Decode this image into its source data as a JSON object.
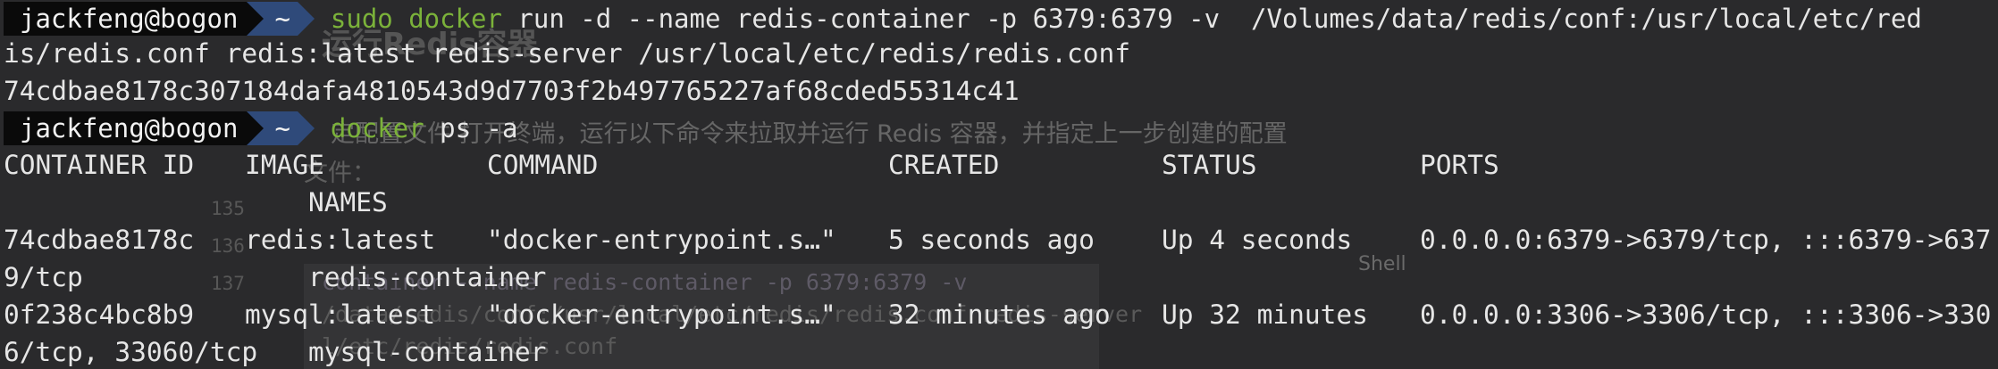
{
  "window": {
    "background": "#2a2a2c",
    "prompt_user_bg": "#0a0a0a",
    "prompt_dir_bg": "#2f4a7a",
    "command_color": "#7bb23a"
  },
  "prompts": [
    {
      "user": "jackfeng@bogon",
      "dir": "~",
      "cmd_keyword": "sudo docker",
      "cmd_args": " run -d --name redis-container -p 6379:6379 -v  /Volumes/data/redis/conf:/usr/local/etc/red"
    },
    {
      "user": "jackfeng@bogon",
      "dir": "~",
      "cmd_keyword": "docker",
      "cmd_args": " ps -a"
    }
  ],
  "output": {
    "wrap_line": "is/redis.conf redis:latest redis-server /usr/local/etc/redis/redis.conf",
    "container_hash": "74cdbae8178c307184dafa4810543d9d7703f2b497765227af68cded55314c41"
  },
  "table": {
    "headers": {
      "container_id": "CONTAINER ID",
      "image": "IMAGE",
      "command": "COMMAND",
      "created": "CREATED",
      "status": "STATUS",
      "ports": "PORTS",
      "names": "NAMES"
    },
    "rows": [
      {
        "container_id": "74cdbae8178c",
        "image": "redis:latest",
        "command": "\"docker-entrypoint.s…\"",
        "created": "5 seconds ago",
        "status": "Up 4 seconds",
        "ports": "0.0.0.0:6379->6379/tcp, :::6379->637",
        "ports_wrap": "9/tcp",
        "names": "redis-container"
      },
      {
        "container_id": "0f238c4bc8b9",
        "image": "mysql:latest",
        "command": "\"docker-entrypoint.s…\"",
        "created": "32 minutes ago",
        "status": "Up 32 minutes",
        "ports": "0.0.0.0:3306->3306/tcp, :::3306->330",
        "ports_wrap": "6/tcp, 33060/tcp",
        "names": "mysql-container"
      }
    ]
  },
  "background_document": {
    "heading": "运行Redis容器",
    "paragraph": "定配置文件 打开终端，运行以下命令来拉取并运行 Redis 容器，并指定上一步创建的配置",
    "paragraph2": "文件：",
    "line_numbers": [
      "135",
      "136",
      "137"
    ],
    "code_lines": [
      "container --name redis-container -p 6379:6379 -v",
      "/data/redis/conf:/usr/local/etc/redis/redis.conf redis-server",
      "l/etc/redis/redis.conf"
    ],
    "code_lang": "Shell"
  }
}
